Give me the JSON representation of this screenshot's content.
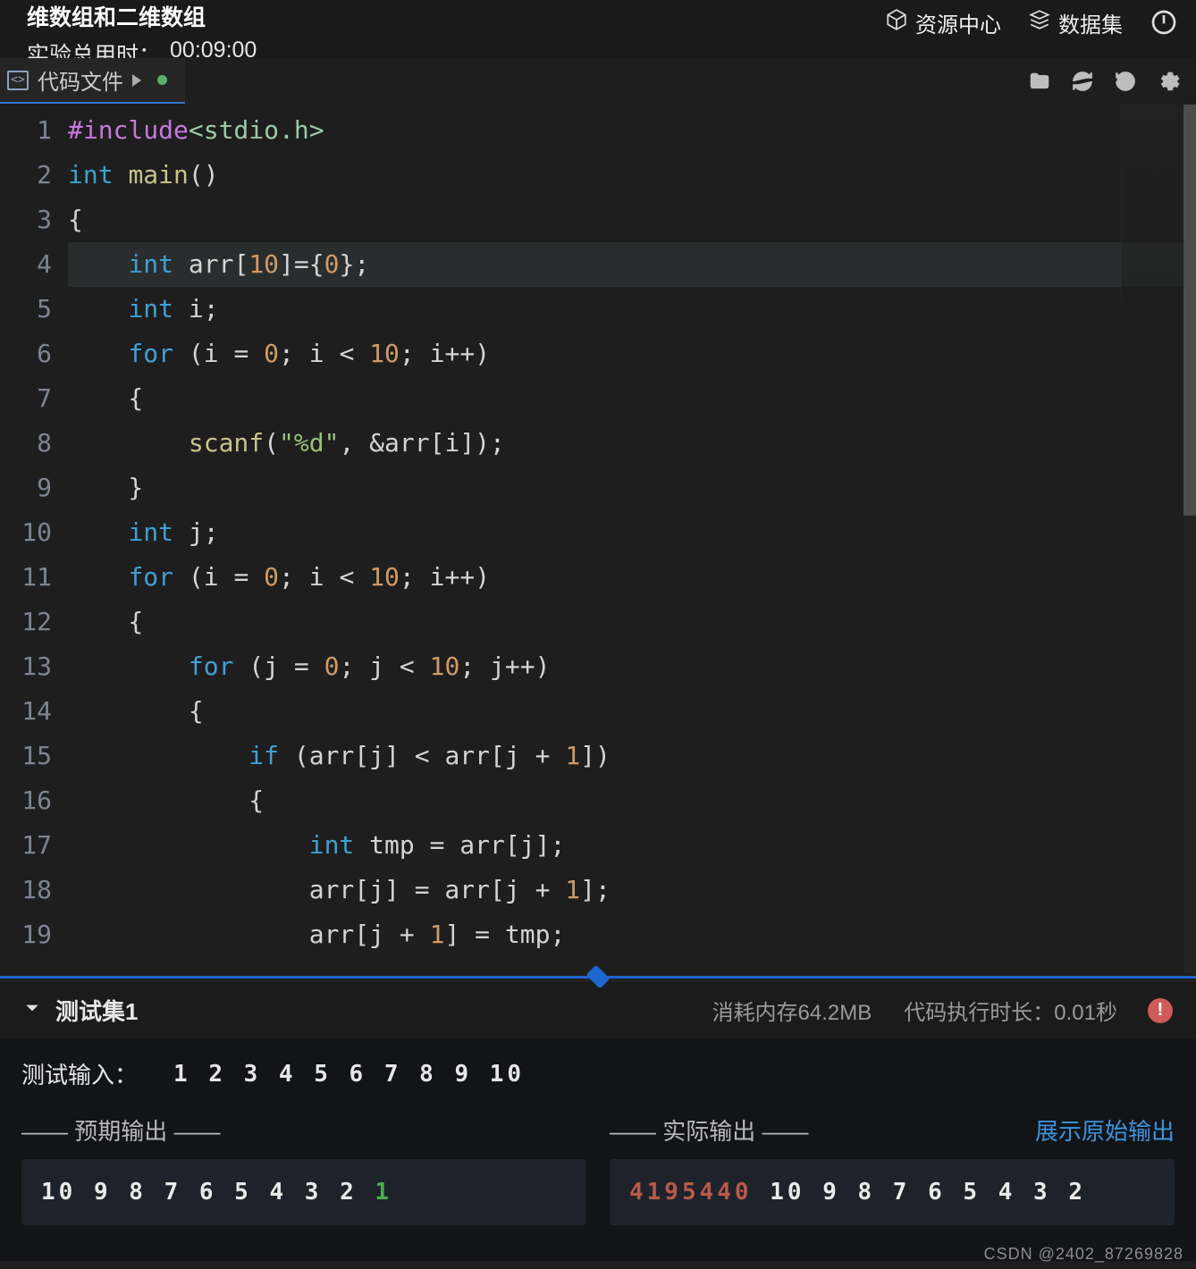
{
  "header": {
    "title": "维数组和二维数组",
    "timer_label": "实验总用时：",
    "timer_value": "00:09:00",
    "links": {
      "resource_center": "资源中心",
      "dataset": "数据集"
    }
  },
  "tab": {
    "label": "代码文件",
    "dirty": true
  },
  "toolbar_icons": {
    "folder": "folder-icon",
    "refresh": "refresh-icon",
    "history": "history-icon",
    "settings": "gear-icon"
  },
  "code": {
    "lines": [
      {
        "n": 1,
        "text": "#include<stdio.h>"
      },
      {
        "n": 2,
        "text": "int main()"
      },
      {
        "n": 3,
        "text": "{"
      },
      {
        "n": 4,
        "text": "    int arr[10]={0};"
      },
      {
        "n": 5,
        "text": "    int i;"
      },
      {
        "n": 6,
        "text": "    for (i = 0; i < 10; i++)"
      },
      {
        "n": 7,
        "text": "    {"
      },
      {
        "n": 8,
        "text": "        scanf(\"%d\", &arr[i]);"
      },
      {
        "n": 9,
        "text": "    }"
      },
      {
        "n": 10,
        "text": "    int j;"
      },
      {
        "n": 11,
        "text": "    for (i = 0; i < 10; i++)"
      },
      {
        "n": 12,
        "text": "    {"
      },
      {
        "n": 13,
        "text": "        for (j = 0; j < 10; j++)"
      },
      {
        "n": 14,
        "text": "        {"
      },
      {
        "n": 15,
        "text": "            if (arr[j] < arr[j + 1])"
      },
      {
        "n": 16,
        "text": "            {"
      },
      {
        "n": 17,
        "text": "                int tmp = arr[j];"
      },
      {
        "n": 18,
        "text": "                arr[j] = arr[j + 1];"
      },
      {
        "n": 19,
        "text": "                arr[j + 1] = tmp;"
      }
    ],
    "current_line": 4
  },
  "panel": {
    "title": "测试集1",
    "memory": "消耗内存64.2MB",
    "exec_time": "代码执行时长：0.01秒",
    "error_badge": "!",
    "test_input_label": "测试输入：",
    "test_input_values": "1 2 3 4 5 6 7 8 9 10",
    "expected_header": "—— 预期输出 ——",
    "actual_header": "—— 实际输出 ——",
    "show_raw": "展示原始输出",
    "expected_output_common": "10 9 8 7 6 5 4 3 2 ",
    "expected_output_diff": "1",
    "actual_output_bad": "4195440 ",
    "actual_output_common": "10 9 8 7 6 5 4 3 2"
  },
  "watermark": "CSDN @2402_87269828"
}
